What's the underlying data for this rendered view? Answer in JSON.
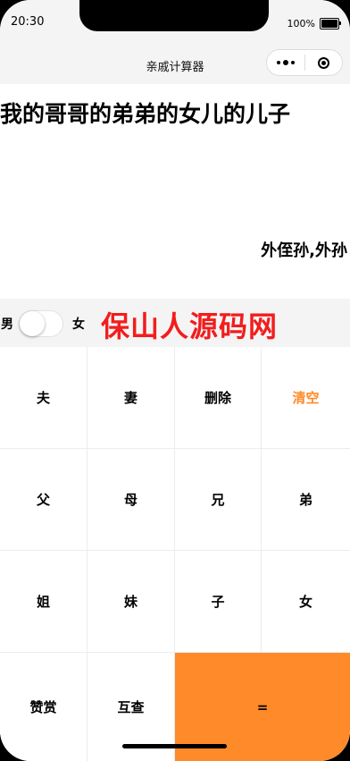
{
  "status_bar": {
    "time": "20:30",
    "battery": "100%"
  },
  "nav": {
    "title": "亲戚计算器"
  },
  "display": {
    "expression": "我的哥哥的弟弟的女儿的儿子",
    "result": "外侄孙,外孙"
  },
  "gender_toggle": {
    "male_label": "男",
    "female_label": "女",
    "selected": "男"
  },
  "watermark": "保山人源码网",
  "keypad": {
    "rows": [
      [
        "夫",
        "妻",
        "删除",
        "清空"
      ],
      [
        "父",
        "母",
        "兄",
        "弟"
      ],
      [
        "姐",
        "妹",
        "子",
        "女"
      ],
      [
        "赞赏",
        "互查",
        "="
      ]
    ]
  },
  "colors": {
    "accent": "#ff8a2a",
    "watermark": "#f21d1d",
    "header_bg": "#f4f4f4"
  }
}
